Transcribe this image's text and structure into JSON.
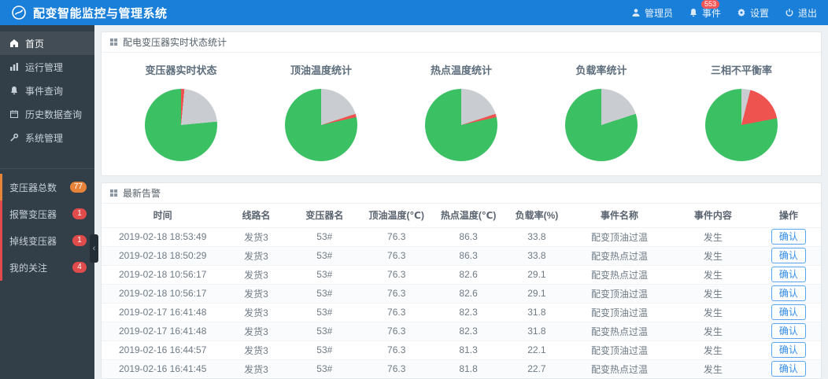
{
  "header": {
    "title": "配变智能监控与管理系统",
    "nav": [
      {
        "key": "admin",
        "label": "管理员",
        "icon": "user"
      },
      {
        "key": "events",
        "label": "事件",
        "icon": "bell",
        "badge": "553"
      },
      {
        "key": "settings",
        "label": "设置",
        "icon": "gear"
      },
      {
        "key": "logout",
        "label": "退出",
        "icon": "power"
      }
    ]
  },
  "sidebar": {
    "menu": [
      {
        "key": "home",
        "label": "首页",
        "icon": "home",
        "active": true
      },
      {
        "key": "run",
        "label": "运行管理",
        "icon": "chart",
        "active": false
      },
      {
        "key": "events",
        "label": "事件查询",
        "icon": "bell",
        "active": false
      },
      {
        "key": "history",
        "label": "历史数据查询",
        "icon": "calendar",
        "active": false
      },
      {
        "key": "system",
        "label": "系统管理",
        "icon": "wrench",
        "active": false
      }
    ],
    "stats": [
      {
        "key": "total",
        "label": "变压器总数",
        "count": "77",
        "color": "#e8833a"
      },
      {
        "key": "alarm",
        "label": "报警变压器",
        "count": "1",
        "color": "#e04b4b"
      },
      {
        "key": "offline",
        "label": "掉线变压器",
        "count": "1",
        "color": "#e04b4b"
      },
      {
        "key": "favorite",
        "label": "我的关注",
        "count": "4",
        "color": "#e04b4b"
      }
    ],
    "collapse_icon": "‹"
  },
  "status_panel": {
    "title": "配电变压器实时状态统计"
  },
  "chart_data": [
    {
      "type": "pie",
      "title": "变压器实时状态",
      "slices": [
        {
          "name": "red",
          "color": "#ef5350",
          "value": 1.5
        },
        {
          "name": "gray",
          "color": "#c9cdd1",
          "value": 22
        },
        {
          "name": "green",
          "color": "#3cc064",
          "value": 76.5
        }
      ]
    },
    {
      "type": "pie",
      "title": "顶油温度统计",
      "slices": [
        {
          "name": "gray",
          "color": "#c9cdd1",
          "value": 20
        },
        {
          "name": "red",
          "color": "#ef5350",
          "value": 1.5
        },
        {
          "name": "green",
          "color": "#3cc064",
          "value": 78.5
        }
      ]
    },
    {
      "type": "pie",
      "title": "热点温度统计",
      "slices": [
        {
          "name": "gray",
          "color": "#c9cdd1",
          "value": 20
        },
        {
          "name": "red",
          "color": "#ef5350",
          "value": 1.5
        },
        {
          "name": "green",
          "color": "#3cc064",
          "value": 78.5
        }
      ]
    },
    {
      "type": "pie",
      "title": "负载率统计",
      "slices": [
        {
          "name": "gray",
          "color": "#c9cdd1",
          "value": 20
        },
        {
          "name": "green",
          "color": "#3cc064",
          "value": 80
        }
      ]
    },
    {
      "type": "pie",
      "title": "三相不平衡率",
      "slices": [
        {
          "name": "gray",
          "color": "#c9cdd1",
          "value": 4
        },
        {
          "name": "red",
          "color": "#ef5350",
          "value": 18
        },
        {
          "name": "green",
          "color": "#3cc064",
          "value": 78
        }
      ]
    }
  ],
  "alarm_panel": {
    "title": "最新告警",
    "columns": [
      "时间",
      "线路名",
      "变压器名",
      "顶油温度(℃)",
      "热点温度(℃)",
      "负载率(%)",
      "事件名称",
      "事件内容",
      "操作"
    ],
    "rows": [
      [
        "2019-02-18 18:53:49",
        "发货3",
        "53#",
        "76.3",
        "86.3",
        "33.8",
        "配变顶油过温",
        "发生"
      ],
      [
        "2019-02-18 18:50:29",
        "发货3",
        "53#",
        "76.3",
        "86.3",
        "33.8",
        "配变热点过温",
        "发生"
      ],
      [
        "2019-02-18 10:56:17",
        "发货3",
        "53#",
        "76.3",
        "82.6",
        "29.1",
        "配变热点过温",
        "发生"
      ],
      [
        "2019-02-18 10:56:17",
        "发货3",
        "53#",
        "76.3",
        "82.6",
        "29.1",
        "配变顶油过温",
        "发生"
      ],
      [
        "2019-02-17 16:41:48",
        "发货3",
        "53#",
        "76.3",
        "82.3",
        "31.8",
        "配变顶油过温",
        "发生"
      ],
      [
        "2019-02-17 16:41:48",
        "发货3",
        "53#",
        "76.3",
        "82.3",
        "31.8",
        "配变热点过温",
        "发生"
      ],
      [
        "2019-02-16 16:44:57",
        "发货3",
        "53#",
        "76.3",
        "81.3",
        "22.1",
        "配变顶油过温",
        "发生"
      ],
      [
        "2019-02-16 16:41:45",
        "发货3",
        "53#",
        "76.3",
        "81.8",
        "22.7",
        "配变热点过温",
        "发生"
      ]
    ],
    "action_label": "确认"
  },
  "colors": {
    "topbar": "#1a7fd9",
    "sidebar": "#323e48",
    "pie_green": "#3cc064",
    "pie_gray": "#c9cdd1",
    "pie_red": "#ef5350"
  }
}
